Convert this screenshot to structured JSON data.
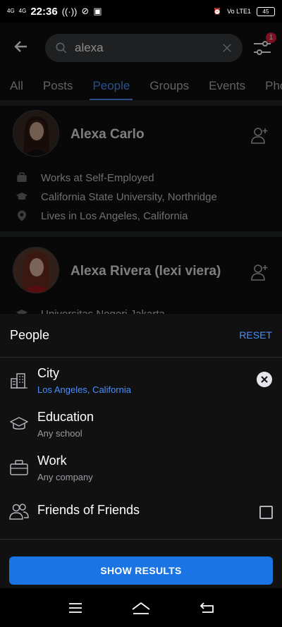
{
  "status_bar": {
    "signal1": "4G",
    "signal2": "4G",
    "time": "22:36",
    "volte": "Vo LTE1",
    "battery": "45"
  },
  "search": {
    "query": "alexa",
    "filter_badge": "1"
  },
  "tabs": [
    "All",
    "Posts",
    "People",
    "Groups",
    "Events",
    "Pho"
  ],
  "active_tab": "People",
  "results": [
    {
      "name": "Alexa Carlo",
      "work": "Works at Self-Employed",
      "education": "California State University, Northridge",
      "location": "Lives in Los Angeles, California"
    },
    {
      "name": "Alexa Rivera (lexi viera)",
      "education": "Universitas Negeri Jakarta"
    }
  ],
  "sheet": {
    "title": "People",
    "reset": "RESET",
    "filters": [
      {
        "label": "City",
        "value": "Los Angeles, California"
      },
      {
        "label": "Education",
        "value": "Any school"
      },
      {
        "label": "Work",
        "value": "Any company"
      },
      {
        "label": "Friends of Friends"
      }
    ],
    "show_results": "SHOW RESULTS"
  },
  "colors": {
    "accent": "#4b8ffa",
    "button": "#1b74e4",
    "badge": "#e41e3f"
  }
}
